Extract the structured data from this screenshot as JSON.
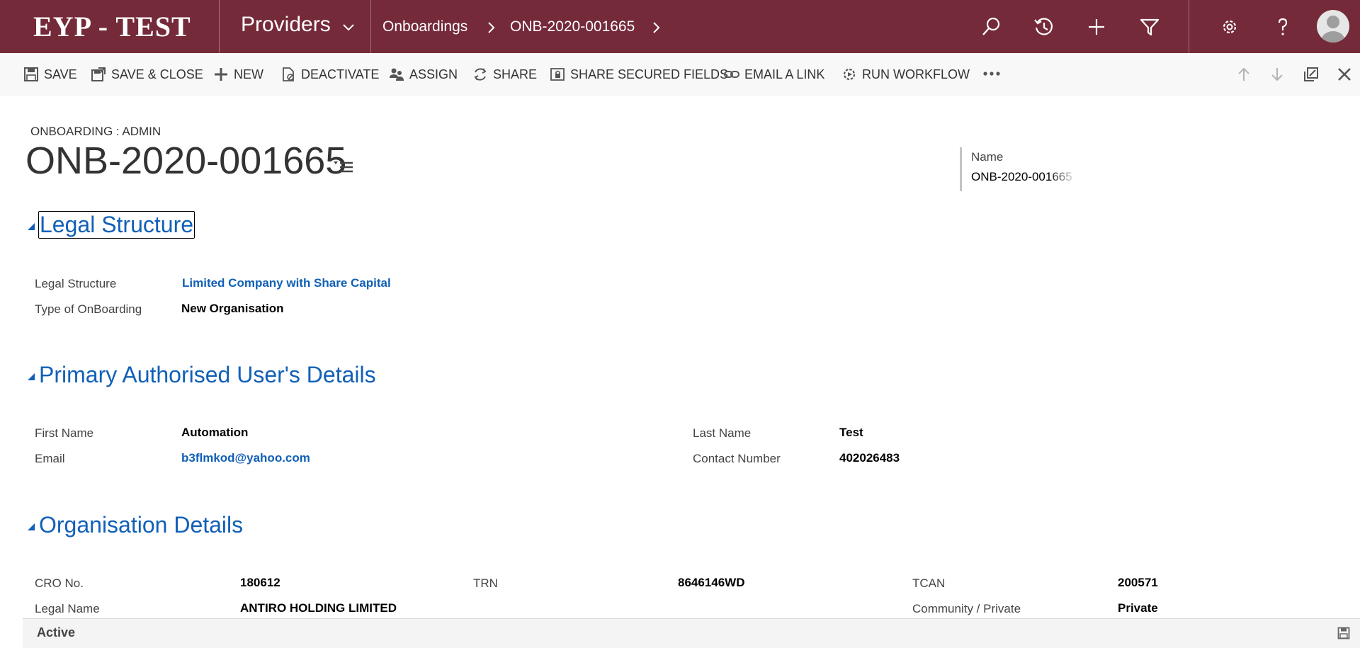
{
  "nav": {
    "brand": "EYP - TEST",
    "area": "Providers",
    "breadcrumb": [
      "Onboardings",
      "ONB-2020-001665"
    ],
    "icons": [
      "search-icon",
      "recent-icon",
      "plus-icon",
      "filter-icon",
      "settings-icon",
      "help-icon",
      "avatar"
    ]
  },
  "toolbar": {
    "save": "SAVE",
    "save_close": "SAVE & CLOSE",
    "new": "NEW",
    "deactivate": "DEACTIVATE",
    "assign": "ASSIGN",
    "share": "SHARE",
    "share_secured": "SHARE SECURED FIELDS",
    "email_link": "EMAIL A LINK",
    "run_workflow": "RUN WORKFLOW"
  },
  "header": {
    "entity": "ONBOARDING : ADMIN",
    "title": "ONB-2020-001665",
    "name_label": "Name",
    "name_value": "ONB-2020-001665"
  },
  "legal": {
    "title": "Legal Structure",
    "legal_structure_label": "Legal Structure",
    "legal_structure_value": "Limited Company with Share Capital",
    "type_label": "Type of OnBoarding",
    "type_value": "New Organisation"
  },
  "user": {
    "title": "Primary Authorised User's Details",
    "first_name_label": "First Name",
    "first_name_value": "Automation",
    "last_name_label": "Last Name",
    "last_name_value": "Test",
    "email_label": "Email",
    "email_value": "b3flmkod@yahoo.com",
    "contact_label": "Contact Number",
    "contact_value": "402026483"
  },
  "org": {
    "title": "Organisation Details",
    "cro_label": "CRO No.",
    "cro_value": "180612",
    "trn_label": "TRN",
    "trn_value": "8646146WD",
    "tcan_label": "TCAN",
    "tcan_value": "200571",
    "legal_name_label": "Legal Name",
    "legal_name_value": "ANTIRO HOLDING LIMITED",
    "community_label": "Community / Private",
    "community_value": "Private"
  },
  "footer": {
    "status": "Active"
  },
  "colors": {
    "brand": "#742a39",
    "link": "#1160b7",
    "commandbar": "#f8f8f8"
  }
}
